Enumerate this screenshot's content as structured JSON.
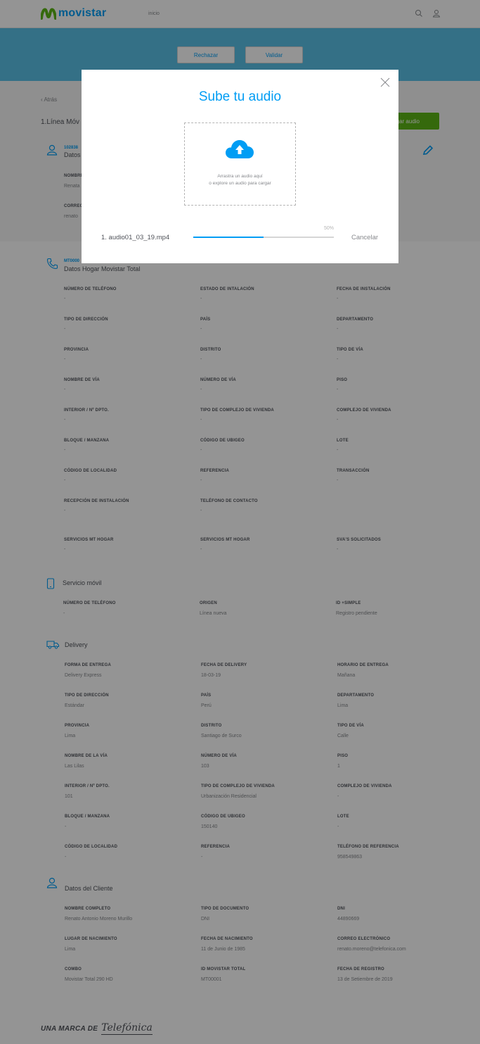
{
  "header": {
    "logo_text": "movistar",
    "nav_inicio": "inicio",
    "search_icon": "search-icon",
    "user_icon": "user-icon"
  },
  "banner": {
    "reject_label": "Rechazar",
    "validate_label": "Validar"
  },
  "page": {
    "back_label": "‹ Atrás",
    "line_title": "1.Línea Móv",
    "green_button_label": "Cargar audio",
    "section1": {
      "code": "102838",
      "title": "Datos",
      "fields": [
        {
          "label": "NOMBRE",
          "value": "Renata"
        },
        {
          "label": "CORREO",
          "value": "renato"
        }
      ]
    }
  },
  "hogar": {
    "code": "MT0000",
    "title": "Datos Hogar Movistar Total",
    "fields": [
      {
        "label": "NÚMERO DE TELÉFONO",
        "value": "-"
      },
      {
        "label": "ESTADO DE INTALACIÓN",
        "value": "-"
      },
      {
        "label": "FECHA DE INSTALACIÓN",
        "value": "-"
      },
      {
        "label": "TIPO DE DIRECCIÓN",
        "value": "-"
      },
      {
        "label": "PAÍS",
        "value": "-"
      },
      {
        "label": "DEPARTAMENTO",
        "value": "-"
      },
      {
        "label": "PROVINCIA",
        "value": "-"
      },
      {
        "label": "DISTRITO",
        "value": "-"
      },
      {
        "label": "TIPO DE VÍA",
        "value": "-"
      },
      {
        "label": "NOMBRE DE VÍA",
        "value": "-"
      },
      {
        "label": "NÚMERO DE VÍA",
        "value": "-"
      },
      {
        "label": "PISO",
        "value": "-"
      },
      {
        "label": "INTERIOR / Nº DPTO.",
        "value": "-"
      },
      {
        "label": "TIPO DE COMPLEJO DE VIVIENDA",
        "value": "-"
      },
      {
        "label": "COMPLEJO DE VIVIENDA",
        "value": "-"
      },
      {
        "label": "BLOQUE / MANZANA",
        "value": "-"
      },
      {
        "label": "CÓDIGO DE UBIGEO",
        "value": "-"
      },
      {
        "label": "LOTE",
        "value": "-"
      },
      {
        "label": "CÓDIGO DE LOCALIDAD",
        "value": "-"
      },
      {
        "label": "REFERENCIA",
        "value": "-"
      },
      {
        "label": "TRANSACCIÓN",
        "value": "-"
      },
      {
        "label": "RECEPCIÓN DE INSTALACIÓN",
        "value": "-"
      },
      {
        "label": "TELÉFONO DE CONTACTO",
        "value": "-"
      },
      {
        "label": "",
        "value": ""
      },
      {
        "label": "SERVICIOS MT HOGAR",
        "value": "-"
      },
      {
        "label": "SERVICIOS MT HOGAR",
        "value": "-"
      },
      {
        "label": "SVA'S SOLICITADOS",
        "value": "-"
      }
    ]
  },
  "movil": {
    "title": "Servicio móvil",
    "fields": [
      {
        "label": "NÚMERO DE TELÉFONO",
        "value": "-"
      },
      {
        "label": "ORIGEN",
        "value": "Línea nueva"
      },
      {
        "label": "ID +Simple",
        "value": "Registro pendiente"
      }
    ]
  },
  "delivery": {
    "title": "Delivery",
    "fields": [
      {
        "label": "FORMA DE ENTREGA",
        "value": "Delivery Express"
      },
      {
        "label": "FECHA DE DELIVERY",
        "value": "18-03-19"
      },
      {
        "label": "HORARIO DE ENTREGA",
        "value": "Mañana"
      },
      {
        "label": "TIPO DE DIRECCIÓN",
        "value": "Estándar"
      },
      {
        "label": "PAÍS",
        "value": "Perú"
      },
      {
        "label": "DEPARTAMENTO",
        "value": "Lima"
      },
      {
        "label": "PROVINCIA",
        "value": "Lima"
      },
      {
        "label": "DISTRITO",
        "value": "Santiago de Surco"
      },
      {
        "label": "TIPO DE VÍA",
        "value": "Calle"
      },
      {
        "label": "NOMBRE DE LA VÍA",
        "value": "Las Lilas"
      },
      {
        "label": "NÚMERO DE VÍA",
        "value": "103"
      },
      {
        "label": "PISO",
        "value": "1"
      },
      {
        "label": "INTERIOR / Nº DPTO.",
        "value": "101"
      },
      {
        "label": "TIPO DE COMPLEJO DE VIVIENDA",
        "value": "Urbanización Residencial"
      },
      {
        "label": "COMPLEJO DE VIVIENDA",
        "value": "-"
      },
      {
        "label": "BLOQUE / MANZANA",
        "value": "-"
      },
      {
        "label": "CÓDIGO DE UBIGEO",
        "value": "150140"
      },
      {
        "label": "LOTE",
        "value": "-"
      },
      {
        "label": "CÓDIGO DE LOCALIDAD",
        "value": "-"
      },
      {
        "label": "REFERENCIA",
        "value": "-"
      },
      {
        "label": "TELÉFONO DE REFERENCIA",
        "value": "958549863"
      }
    ]
  },
  "cliente": {
    "title": "Datos del Cliente",
    "fields": [
      {
        "label": "NOMBRE COMPLETO",
        "value": "Renato Antonio Moreno Murillo"
      },
      {
        "label": "TIPO DE DOCUMENTO",
        "value": "DNI"
      },
      {
        "label": "DNI",
        "value": "44890669"
      },
      {
        "label": "LUGAR DE NACIMIENTO",
        "value": "Lima"
      },
      {
        "label": "FECHA DE NACIMIENTO",
        "value": "11 de Junio de 1985"
      },
      {
        "label": "CORREO ELECTRÓNICO",
        "value": "renato.moreno@telefonica.com"
      },
      {
        "label": "COMBO",
        "value": "Movistar Total 290 HD"
      },
      {
        "label": "ID MOVISTAR TOTAL",
        "value": "MT00001"
      },
      {
        "label": "FECHA DE REGISTRO",
        "value": "13 de Setiembre de 2019"
      }
    ]
  },
  "modal": {
    "title": "Sube tu audio",
    "drop_line1": "Arrastra un audio aquí",
    "drop_line2": "o explore un audio para cargar",
    "file_name": "1. audio01_03_19.mp4",
    "progress_label": "50%",
    "progress_value": 0.5,
    "cancel_label": "Cancelar",
    "close_icon": "close-icon",
    "upload_icon": "cloud-upload-icon"
  },
  "footer": {
    "text": "UNA MARCA DE",
    "brand": "Telefónica"
  },
  "colors": {
    "accent": "#019df4",
    "banner": "#5bc2e7",
    "green": "#5cb615"
  }
}
